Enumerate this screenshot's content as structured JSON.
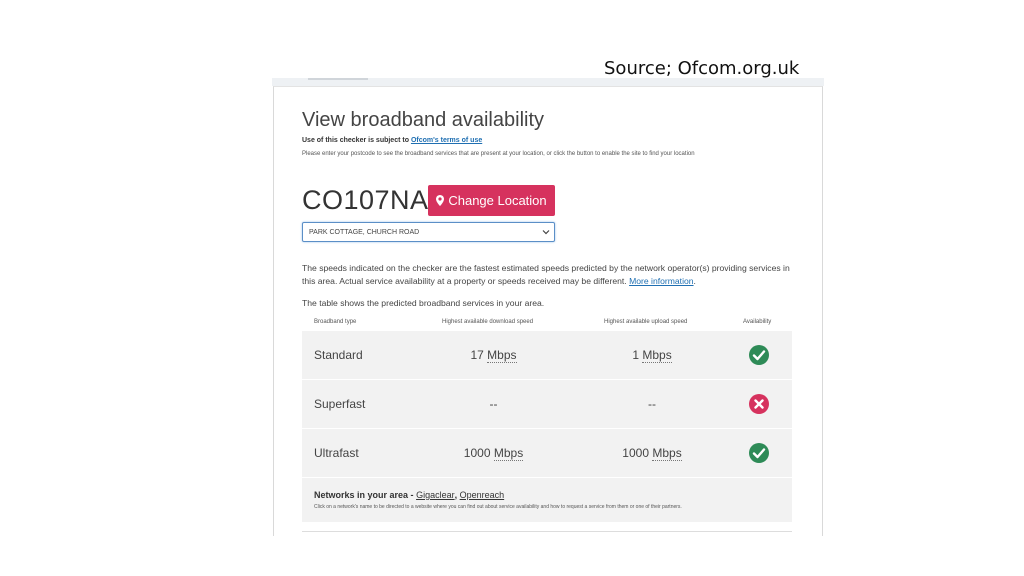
{
  "source_caption": "Source; Ofcom.org.uk",
  "page": {
    "title": "View broadband availability",
    "terms_prefix": "Use of this checker is subject to",
    "terms_link": "Ofcom's terms of use",
    "instruction": "Please enter your postcode to see the broadband services that are present at your location, or click the button to enable the site to find your location"
  },
  "location": {
    "postcode": "CO107NA",
    "change_button_label": "Change Location",
    "address_selected": "PARK COTTAGE, CHURCH ROAD"
  },
  "disclaimer": {
    "text": "The speeds indicated on the checker are the fastest estimated speeds predicted by the network operator(s) providing services in this area. Actual service availability at a property or speeds received may be different.",
    "link": "More information",
    "end": "."
  },
  "table_intro": "The table shows the predicted broadband services in your area.",
  "table": {
    "headers": {
      "type": "Broadband type",
      "download": "Highest available download speed",
      "upload": "Highest available upload speed",
      "availability": "Availability"
    },
    "rows": [
      {
        "type": "Standard",
        "download_value": "17",
        "download_unit": "Mbps",
        "upload_value": "1",
        "upload_unit": "Mbps",
        "available": true,
        "status_icon": "check-circle-icon"
      },
      {
        "type": "Superfast",
        "download_value": "--",
        "download_unit": "",
        "upload_value": "--",
        "upload_unit": "",
        "available": false,
        "status_icon": "cross-circle-icon"
      },
      {
        "type": "Ultrafast",
        "download_value": "1000",
        "download_unit": "Mbps",
        "upload_value": "1000",
        "upload_unit": "Mbps",
        "available": true,
        "status_icon": "check-circle-icon"
      }
    ]
  },
  "networks": {
    "label": "Networks in your area -",
    "providers": [
      "Gigaclear",
      "Openreach"
    ],
    "separator": ",",
    "note": "Click on a network's name to be directed to a website where you can find out about service availability and how to request a service from them or one of their partners."
  },
  "colors": {
    "button": "#d6325e",
    "link": "#1f6fb2",
    "available": "#2e8b57",
    "unavailable": "#d6325e",
    "row_background": "#f2f2f2"
  }
}
